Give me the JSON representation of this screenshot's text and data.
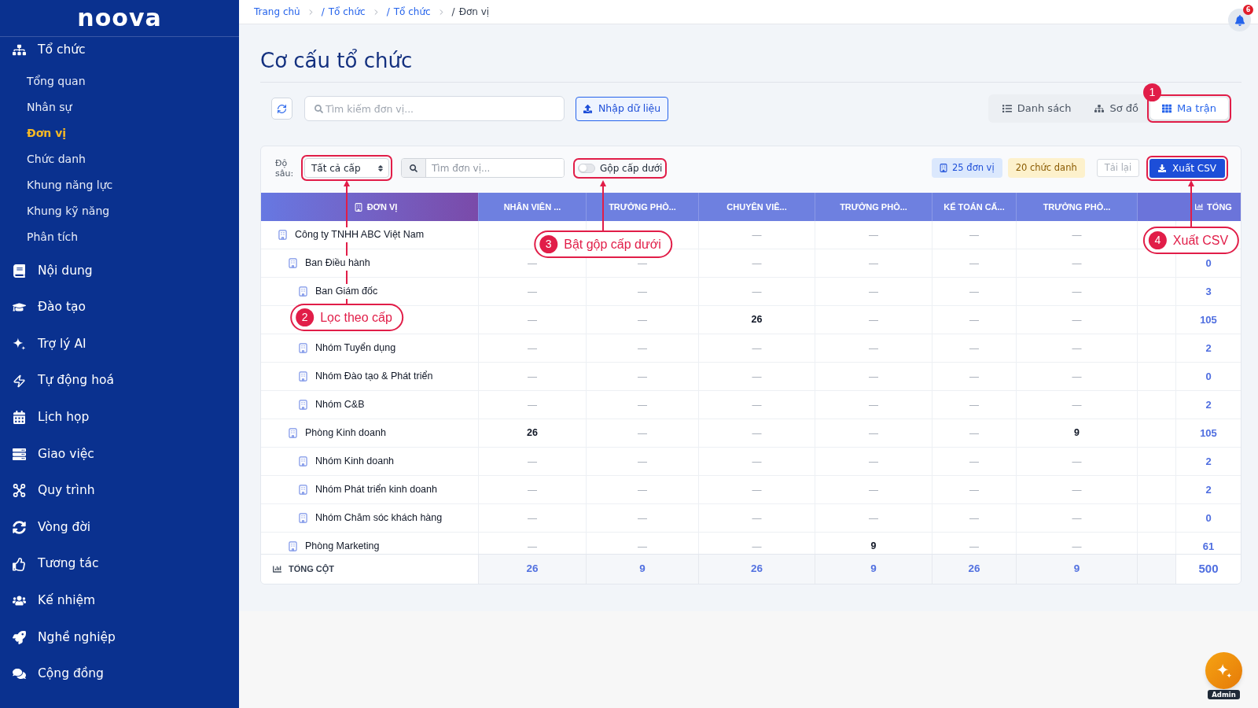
{
  "sidebar": {
    "logo": "noova",
    "items": [
      {
        "label": "Tổ chức",
        "selected": false,
        "children": [
          {
            "label": "Tổng quan",
            "selected": false
          },
          {
            "label": "Nhân sự",
            "selected": false
          },
          {
            "label": "Đơn vị",
            "selected": true
          },
          {
            "label": "Chức danh",
            "selected": false
          },
          {
            "label": "Khung năng lực",
            "selected": false
          },
          {
            "label": "Khung kỹ năng",
            "selected": false
          },
          {
            "label": "Phân tích",
            "selected": false
          }
        ]
      },
      {
        "label": "Nội dung",
        "selected": false
      },
      {
        "label": "Đào tạo",
        "selected": false
      },
      {
        "label": "Trợ lý AI",
        "selected": false
      },
      {
        "label": "Tự động hoá",
        "selected": false
      },
      {
        "label": "Lịch họp",
        "selected": false
      },
      {
        "label": "Giao việc",
        "selected": false
      },
      {
        "label": "Quy trình",
        "selected": false
      },
      {
        "label": "Vòng đời",
        "selected": false
      },
      {
        "label": "Tương tác",
        "selected": false
      },
      {
        "label": "Kế nhiệm",
        "selected": false
      },
      {
        "label": "Nghề nghiệp",
        "selected": false
      },
      {
        "label": "Cộng đồng",
        "selected": false
      }
    ]
  },
  "breadcrumb": {
    "separator": "/",
    "items": [
      {
        "label": "Trang chủ",
        "current": false
      },
      {
        "label": "Tổ chức",
        "current": false
      },
      {
        "label": "Tổ chức",
        "current": false
      },
      {
        "label": "Đơn vị",
        "current": true
      }
    ]
  },
  "notifications": {
    "count": "6"
  },
  "page_title": "Cơ cấu tổ chức",
  "toolbar": {
    "search": {
      "placeholder": "Tìm kiếm đơn vị..."
    },
    "import_button": "Nhập dữ liệu",
    "views": [
      {
        "label": "Danh sách",
        "selected": false
      },
      {
        "label": "Sơ đồ",
        "selected": false
      },
      {
        "label": "Ma trận",
        "selected": true
      }
    ]
  },
  "filters": {
    "depth_label": "Độ sâu:",
    "depth_select": {
      "value": "Tất cả cấp"
    },
    "search": {
      "placeholder": "Tìm đơn vị..."
    },
    "merge_toggle": {
      "label": "Gộp cấp dưới",
      "on": false
    },
    "badges": [
      {
        "text": "25 đơn vị",
        "kind": "units"
      },
      {
        "text": "20 chức danh",
        "kind": "titles"
      }
    ],
    "reload_button": {
      "label": "Tải lại",
      "disabled": true
    },
    "export_button": {
      "label": "Xuất CSV"
    }
  },
  "table": {
    "unit_column": "ĐƠN VỊ",
    "columns": [
      "NHÂN VIÊN ...",
      "TRƯỞNG PHÒ...",
      "CHUYÊN VIÊ...",
      "TRƯỞNG PHÒ...",
      "KẾ TOÁN CẤ...",
      "TRƯỞNG PHÒ..."
    ],
    "total_column": "TỔNG",
    "rows": [
      {
        "name": "Công ty TNHH ABC Việt Nam",
        "cells": [
          null,
          null,
          {
            "text": "—",
            "kind": "empty"
          },
          {
            "text": "—",
            "kind": "empty"
          },
          {
            "text": "—",
            "kind": "empty"
          },
          {
            "text": "—",
            "kind": "empty"
          }
        ],
        "children": [
          {
            "name": "Ban Điều hành",
            "cells": [
              {
                "text": "—",
                "kind": "empty"
              },
              {
                "text": "—",
                "kind": "empty"
              },
              {
                "text": "—",
                "kind": "empty"
              },
              {
                "text": "—",
                "kind": "empty"
              },
              {
                "text": "—",
                "kind": "empty"
              },
              {
                "text": "—",
                "kind": "empty"
              }
            ],
            "total": "0",
            "children": [
              {
                "name": "Ban Giám đốc",
                "cells": [
                  {
                    "text": "—",
                    "kind": "empty"
                  },
                  {
                    "text": "—",
                    "kind": "empty"
                  },
                  {
                    "text": "—",
                    "kind": "empty"
                  },
                  {
                    "text": "—",
                    "kind": "empty"
                  },
                  {
                    "text": "—",
                    "kind": "empty"
                  },
                  {
                    "text": "—",
                    "kind": "empty"
                  }
                ],
                "total": "3"
              }
            ]
          },
          {
            "cells": [
              {
                "text": "—",
                "kind": "empty"
              },
              {
                "text": "—",
                "kind": "empty"
              },
              {
                "text": "26",
                "kind": "count"
              },
              {
                "text": "—",
                "kind": "empty"
              },
              {
                "text": "—",
                "kind": "empty"
              },
              {
                "text": "—",
                "kind": "empty"
              }
            ],
            "total": "105",
            "children": [
              {
                "name": "Nhóm Tuyển dụng",
                "cells": [
                  {
                    "text": "—",
                    "kind": "empty"
                  },
                  {
                    "text": "—",
                    "kind": "empty"
                  },
                  {
                    "text": "—",
                    "kind": "empty"
                  },
                  {
                    "text": "—",
                    "kind": "empty"
                  },
                  {
                    "text": "—",
                    "kind": "empty"
                  },
                  {
                    "text": "—",
                    "kind": "empty"
                  }
                ],
                "total": "2"
              },
              {
                "name": "Nhóm Đào tạo & Phát triển",
                "cells": [
                  {
                    "text": "—",
                    "kind": "empty"
                  },
                  {
                    "text": "—",
                    "kind": "empty"
                  },
                  {
                    "text": "—",
                    "kind": "empty"
                  },
                  {
                    "text": "—",
                    "kind": "empty"
                  },
                  {
                    "text": "—",
                    "kind": "empty"
                  },
                  {
                    "text": "—",
                    "kind": "empty"
                  }
                ],
                "total": "0"
              },
              {
                "name": "Nhóm C&B",
                "cells": [
                  {
                    "text": "—",
                    "kind": "empty"
                  },
                  {
                    "text": "—",
                    "kind": "empty"
                  },
                  {
                    "text": "—",
                    "kind": "empty"
                  },
                  {
                    "text": "—",
                    "kind": "empty"
                  },
                  {
                    "text": "—",
                    "kind": "empty"
                  },
                  {
                    "text": "—",
                    "kind": "empty"
                  }
                ],
                "total": "2"
              }
            ]
          },
          {
            "name": "Phòng Kinh doanh",
            "cells": [
              {
                "text": "26",
                "kind": "count"
              },
              {
                "text": "—",
                "kind": "empty"
              },
              {
                "text": "—",
                "kind": "empty"
              },
              {
                "text": "—",
                "kind": "empty"
              },
              {
                "text": "—",
                "kind": "empty"
              },
              {
                "text": "9",
                "kind": "count"
              }
            ],
            "total": "105",
            "children": [
              {
                "name": "Nhóm Kinh doanh",
                "cells": [
                  {
                    "text": "—",
                    "kind": "empty"
                  },
                  {
                    "text": "—",
                    "kind": "empty"
                  },
                  {
                    "text": "—",
                    "kind": "empty"
                  },
                  {
                    "text": "—",
                    "kind": "empty"
                  },
                  {
                    "text": "—",
                    "kind": "empty"
                  },
                  {
                    "text": "—",
                    "kind": "empty"
                  }
                ],
                "total": "2"
              },
              {
                "name": "Nhóm Phát triển kinh doanh",
                "cells": [
                  {
                    "text": "—",
                    "kind": "empty"
                  },
                  {
                    "text": "—",
                    "kind": "empty"
                  },
                  {
                    "text": "—",
                    "kind": "empty"
                  },
                  {
                    "text": "—",
                    "kind": "empty"
                  },
                  {
                    "text": "—",
                    "kind": "empty"
                  },
                  {
                    "text": "—",
                    "kind": "empty"
                  }
                ],
                "total": "2"
              },
              {
                "name": "Nhóm Chăm sóc khách hàng",
                "cells": [
                  {
                    "text": "—",
                    "kind": "empty"
                  },
                  {
                    "text": "—",
                    "kind": "empty"
                  },
                  {
                    "text": "—",
                    "kind": "empty"
                  },
                  {
                    "text": "—",
                    "kind": "empty"
                  },
                  {
                    "text": "—",
                    "kind": "empty"
                  },
                  {
                    "text": "—",
                    "kind": "empty"
                  }
                ],
                "total": "0"
              }
            ]
          },
          {
            "name": "Phòng Marketing",
            "cells": [
              {
                "text": "—",
                "kind": "empty"
              },
              {
                "text": "—",
                "kind": "empty"
              },
              {
                "text": "—",
                "kind": "empty"
              },
              {
                "text": "9",
                "kind": "count"
              },
              {
                "text": "—",
                "kind": "empty"
              },
              {
                "text": "—",
                "kind": "empty"
              }
            ],
            "total": "61"
          }
        ]
      }
    ],
    "footer": {
      "label": "TỔNG CỘT",
      "values": [
        "26",
        "9",
        "26",
        "9",
        "26",
        "9"
      ],
      "total": "500"
    }
  },
  "annotations": [
    {
      "number": "1"
    },
    {
      "number": "2",
      "label": "Lọc theo cấp"
    },
    {
      "number": "3",
      "label": "Bật gộp cấp dưới"
    },
    {
      "number": "4",
      "label": "Xuất CSV"
    }
  ],
  "assistant_button": {
    "badge": "Admin"
  }
}
